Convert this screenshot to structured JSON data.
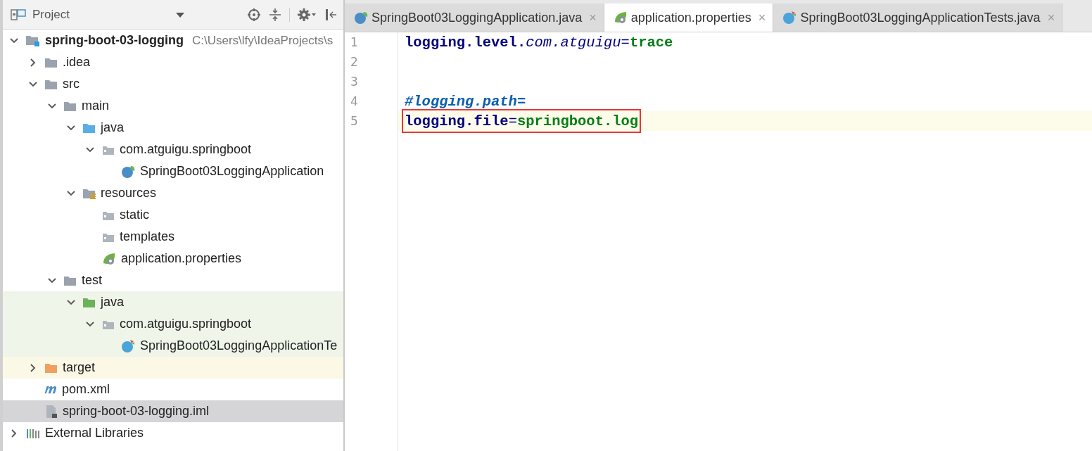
{
  "project_panel": {
    "title": "Project",
    "tree": [
      {
        "label": "spring-boot-03-logging",
        "path": "C:\\Users\\lfy\\IdeaProjects\\s",
        "kind": "module",
        "expanded": true,
        "selected": false,
        "children": [
          {
            "label": ".idea",
            "kind": "folder",
            "expanded": false,
            "selected": false
          },
          {
            "label": "src",
            "kind": "folder",
            "expanded": true,
            "selected": false,
            "children": [
              {
                "label": "main",
                "kind": "folder",
                "expanded": true,
                "selected": false,
                "children": [
                  {
                    "label": "java",
                    "kind": "source-folder",
                    "expanded": true,
                    "selected": false,
                    "children": [
                      {
                        "label": "com.atguigu.springboot",
                        "kind": "package",
                        "expanded": true,
                        "selected": false,
                        "children": [
                          {
                            "label": "SpringBoot03LoggingApplication",
                            "kind": "spring-class",
                            "selected": false
                          }
                        ]
                      }
                    ]
                  },
                  {
                    "label": "resources",
                    "kind": "resource-folder",
                    "expanded": true,
                    "selected": false,
                    "children": [
                      {
                        "label": "static",
                        "kind": "package",
                        "selected": false
                      },
                      {
                        "label": "templates",
                        "kind": "package",
                        "selected": false
                      },
                      {
                        "label": "application.properties",
                        "kind": "spring-properties",
                        "selected": false
                      }
                    ]
                  }
                ]
              },
              {
                "label": "test",
                "kind": "folder",
                "expanded": true,
                "selected": false,
                "children": [
                  {
                    "label": "java",
                    "kind": "test-folder",
                    "expanded": true,
                    "selected": false,
                    "children": [
                      {
                        "label": "com.atguigu.springboot",
                        "kind": "package",
                        "expanded": true,
                        "selected": false,
                        "children": [
                          {
                            "label": "SpringBoot03LoggingApplicationTe",
                            "kind": "test-class",
                            "selected": false
                          }
                        ]
                      }
                    ]
                  }
                ]
              }
            ]
          },
          {
            "label": "target",
            "kind": "excluded-folder",
            "expanded": false,
            "selected": false
          },
          {
            "label": "pom.xml",
            "kind": "maven",
            "selected": false
          },
          {
            "label": "spring-boot-03-logging.iml",
            "kind": "iml",
            "selected": true
          }
        ]
      },
      {
        "label": "External Libraries",
        "kind": "libraries",
        "expanded": false,
        "selected": false
      }
    ]
  },
  "editor": {
    "tabs": [
      {
        "label": "SpringBoot03LoggingApplication.java",
        "kind": "spring-class",
        "selected": false,
        "close": "×"
      },
      {
        "label": "application.properties",
        "kind": "spring-properties",
        "selected": true,
        "close": "×"
      },
      {
        "label": "SpringBoot03LoggingApplicationTests.java",
        "kind": "test-class",
        "selected": false,
        "close": "×"
      }
    ],
    "lines": [
      {
        "number": "1",
        "current": false,
        "boxed": false,
        "tokens": [
          {
            "text": "logging.level.",
            "kind": "key"
          },
          {
            "text": "com.atguigu",
            "kind": "subkey"
          },
          {
            "text": "=",
            "kind": "op"
          },
          {
            "text": "trace",
            "kind": "value"
          }
        ]
      },
      {
        "number": "2"
      },
      {
        "number": "3"
      },
      {
        "number": "4",
        "current": false,
        "boxed": false,
        "tokens": [
          {
            "text": "#logging.path=",
            "kind": "comment"
          }
        ]
      },
      {
        "number": "5",
        "current": true,
        "boxed": true,
        "tokens": [
          {
            "text": "logging.file",
            "kind": "key"
          },
          {
            "text": "=",
            "kind": "op"
          },
          {
            "text": "springboot.log",
            "kind": "value"
          }
        ]
      }
    ]
  }
}
